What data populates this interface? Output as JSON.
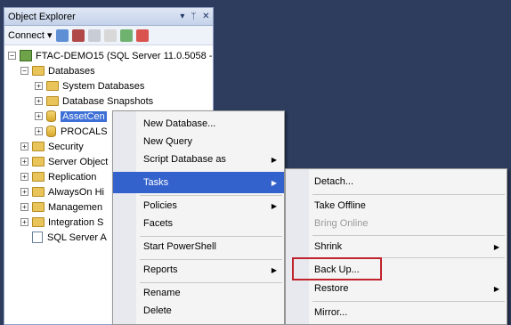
{
  "object_explorer": {
    "title": "Object Explorer",
    "title_controls": [
      "▾",
      "ᛘ",
      "✕"
    ],
    "toolbar": {
      "connect_label": "Connect"
    },
    "tree": {
      "server": "FTAC-DEMO15 (SQL Server 11.0.5058 -",
      "databases": "Databases",
      "system_databases": "System Databases",
      "database_snapshots": "Database Snapshots",
      "assetcen": "AssetCen",
      "procal": "PROCALS",
      "security": "Security",
      "server_objects": "Server Object",
      "replication": "Replication",
      "alwayson": "AlwaysOn Hi",
      "management": "Managemen",
      "integration": "Integration S",
      "sql_agent": "SQL Server A"
    }
  },
  "context_menu": {
    "new_database": "New Database...",
    "new_query": "New Query",
    "script_database_as": "Script Database as",
    "tasks": "Tasks",
    "policies": "Policies",
    "facets": "Facets",
    "start_powershell": "Start PowerShell",
    "reports": "Reports",
    "rename": "Rename",
    "delete": "Delete"
  },
  "tasks_submenu": {
    "detach": "Detach...",
    "take_offline": "Take Offline",
    "bring_online": "Bring Online",
    "shrink": "Shrink",
    "back_up": "Back Up...",
    "restore": "Restore",
    "mirror": "Mirror..."
  },
  "colors": {
    "background": "#2e3d5e",
    "highlight": "#3462cc",
    "callout_border": "#c0232c"
  }
}
